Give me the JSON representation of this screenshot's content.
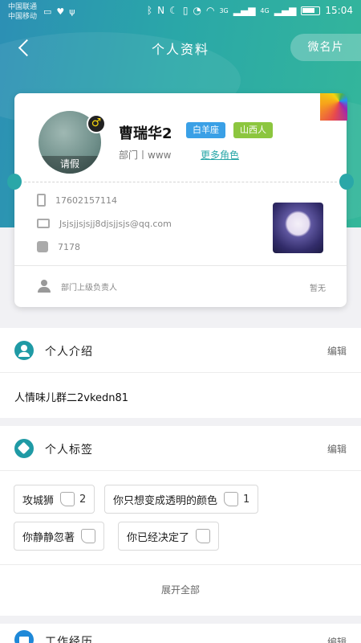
{
  "status_bar": {
    "carrier_1": "中国联通",
    "carrier_2": "中国移动",
    "net_3g": "3G",
    "net_4g": "4G",
    "time": "15:04"
  },
  "topbar": {
    "title": "个人资料",
    "micro_card_label": "微名片"
  },
  "profile": {
    "avatar_label": "请假",
    "gender_symbol": "♂",
    "name": "曹瑞华2",
    "zodiac_tag": "白羊座",
    "region_tag": "山西人",
    "department": "部门丨www",
    "more_roles": "更多角色",
    "mobile": "17602157114",
    "email": "Jsjsjjsjsjj8djsjjsjs@qq.com",
    "phone": "7178",
    "superior_label": "部门上级负责人",
    "superior_value": "暂无"
  },
  "intro_section": {
    "title": "个人介绍",
    "edit": "编辑",
    "text": "人情味儿群二2vkedn81"
  },
  "tags_section": {
    "title": "个人标签",
    "edit": "编辑",
    "tags": [
      {
        "label": "攻城狮",
        "count": "2"
      },
      {
        "label": "你只想变成透明的颜色",
        "count": "1"
      },
      {
        "label": "你静静忽著",
        "count": ""
      },
      {
        "label": "你已经决定了",
        "count": ""
      }
    ],
    "expand_all": "展开全部"
  },
  "work_section": {
    "title": "工作经历",
    "edit": "编辑"
  },
  "colors": {
    "accent": "#2aa7a8",
    "zodiac_tag": "#3aa0e6",
    "region_tag": "#8cc63f"
  }
}
